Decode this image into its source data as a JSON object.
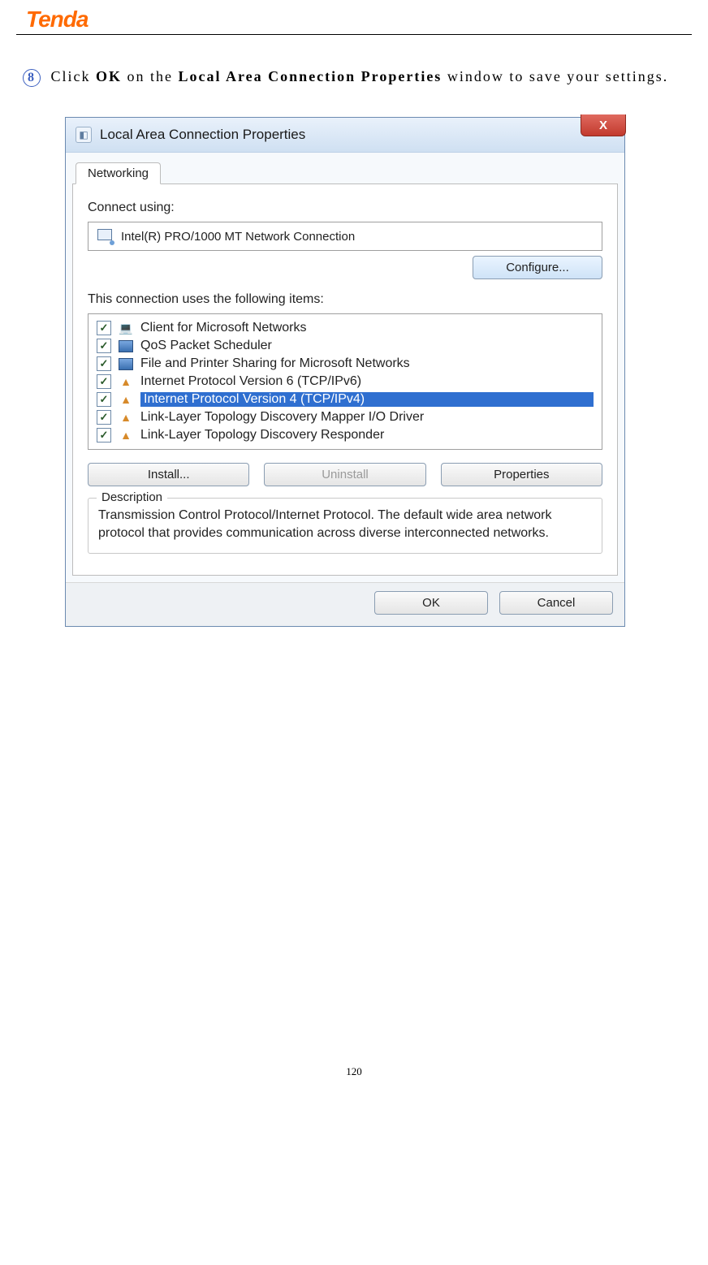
{
  "header": {
    "logo_text": "Tenda"
  },
  "instruction": {
    "step_number": "8",
    "pre": "Click ",
    "bold1": "OK",
    "mid": " on the ",
    "bold2": "Local Area Connection Properties",
    "post": " window to save your settings."
  },
  "window": {
    "title": "Local Area Connection Properties",
    "close_glyph": "X",
    "tab": "Networking",
    "connect_label": "Connect using:",
    "adapter": "Intel(R) PRO/1000 MT Network Connection",
    "configure_btn": "Configure...",
    "items_label": "This connection uses the following items:",
    "items": [
      {
        "checked": true,
        "icon": "net",
        "label": "Client for Microsoft Networks",
        "selected": false
      },
      {
        "checked": true,
        "icon": "mon",
        "label": "QoS Packet Scheduler",
        "selected": false
      },
      {
        "checked": true,
        "icon": "mon",
        "label": "File and Printer Sharing for Microsoft Networks",
        "selected": false
      },
      {
        "checked": true,
        "icon": "proto",
        "label": "Internet Protocol Version 6 (TCP/IPv6)",
        "selected": false
      },
      {
        "checked": true,
        "icon": "proto",
        "label": "Internet Protocol Version 4 (TCP/IPv4)",
        "selected": true
      },
      {
        "checked": true,
        "icon": "proto",
        "label": "Link-Layer Topology Discovery Mapper I/O Driver",
        "selected": false
      },
      {
        "checked": true,
        "icon": "proto",
        "label": "Link-Layer Topology Discovery Responder",
        "selected": false
      }
    ],
    "install_btn": "Install...",
    "uninstall_btn": "Uninstall",
    "properties_btn": "Properties",
    "desc_legend": "Description",
    "desc_text": "Transmission Control Protocol/Internet Protocol. The default wide area network protocol that provides communication across diverse interconnected networks.",
    "ok_btn": "OK",
    "cancel_btn": "Cancel"
  },
  "page_number": "120"
}
